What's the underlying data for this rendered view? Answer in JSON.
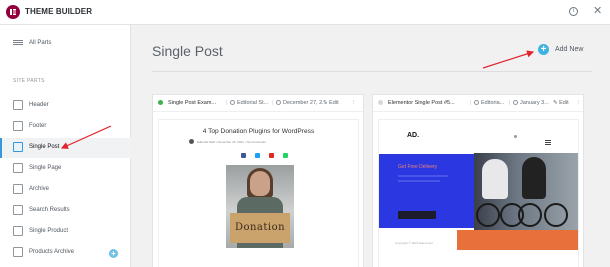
{
  "app": {
    "title": "THEME BUILDER"
  },
  "topbar": {
    "info_icon": "info-icon",
    "info_glyph": "i",
    "close_icon": "close-icon",
    "close_glyph": "✕"
  },
  "sidebar": {
    "all_parts": "All Parts",
    "section_label": "SITE PARTS",
    "items": [
      {
        "label": "Header",
        "icon": "header-icon"
      },
      {
        "label": "Footer",
        "icon": "footer-icon"
      },
      {
        "label": "Single Post",
        "icon": "single-post-icon",
        "active": true
      },
      {
        "label": "Single Page",
        "icon": "single-page-icon"
      },
      {
        "label": "Archive",
        "icon": "archive-icon"
      },
      {
        "label": "Search Results",
        "icon": "search-results-icon"
      },
      {
        "label": "Single Product",
        "icon": "single-product-icon"
      },
      {
        "label": "Products Archive",
        "icon": "products-archive-icon",
        "badge": "+"
      }
    ]
  },
  "main": {
    "title": "Single Post",
    "add_new": "Add New",
    "add_new_glyph": "+"
  },
  "cards": [
    {
      "name": "Single Post Exam...",
      "author": "Editorial St...",
      "date": "December 27, 2...",
      "edit": "Edit",
      "status_color": "#39b54a",
      "preview": {
        "title": "4 Top Donation Plugins for WordPress",
        "meta": "Editorial Staff  •  December 25, 2021  •  No Comments",
        "sign_text": "Donation"
      }
    },
    {
      "name": "Elementor Single Post #5...",
      "author": "Editoria...",
      "date": "January 3...",
      "edit": "Edit",
      "status_color": "#d5d8dc",
      "preview": {
        "logo": "AD.",
        "headline": "Get Free Delivery",
        "footer": "Copyright © 2021 Elementor"
      }
    }
  ],
  "colors": {
    "accent": "#3498db",
    "add_new": "#3fb3e0",
    "arrow": "#e0262b",
    "logo": "#92003b"
  }
}
